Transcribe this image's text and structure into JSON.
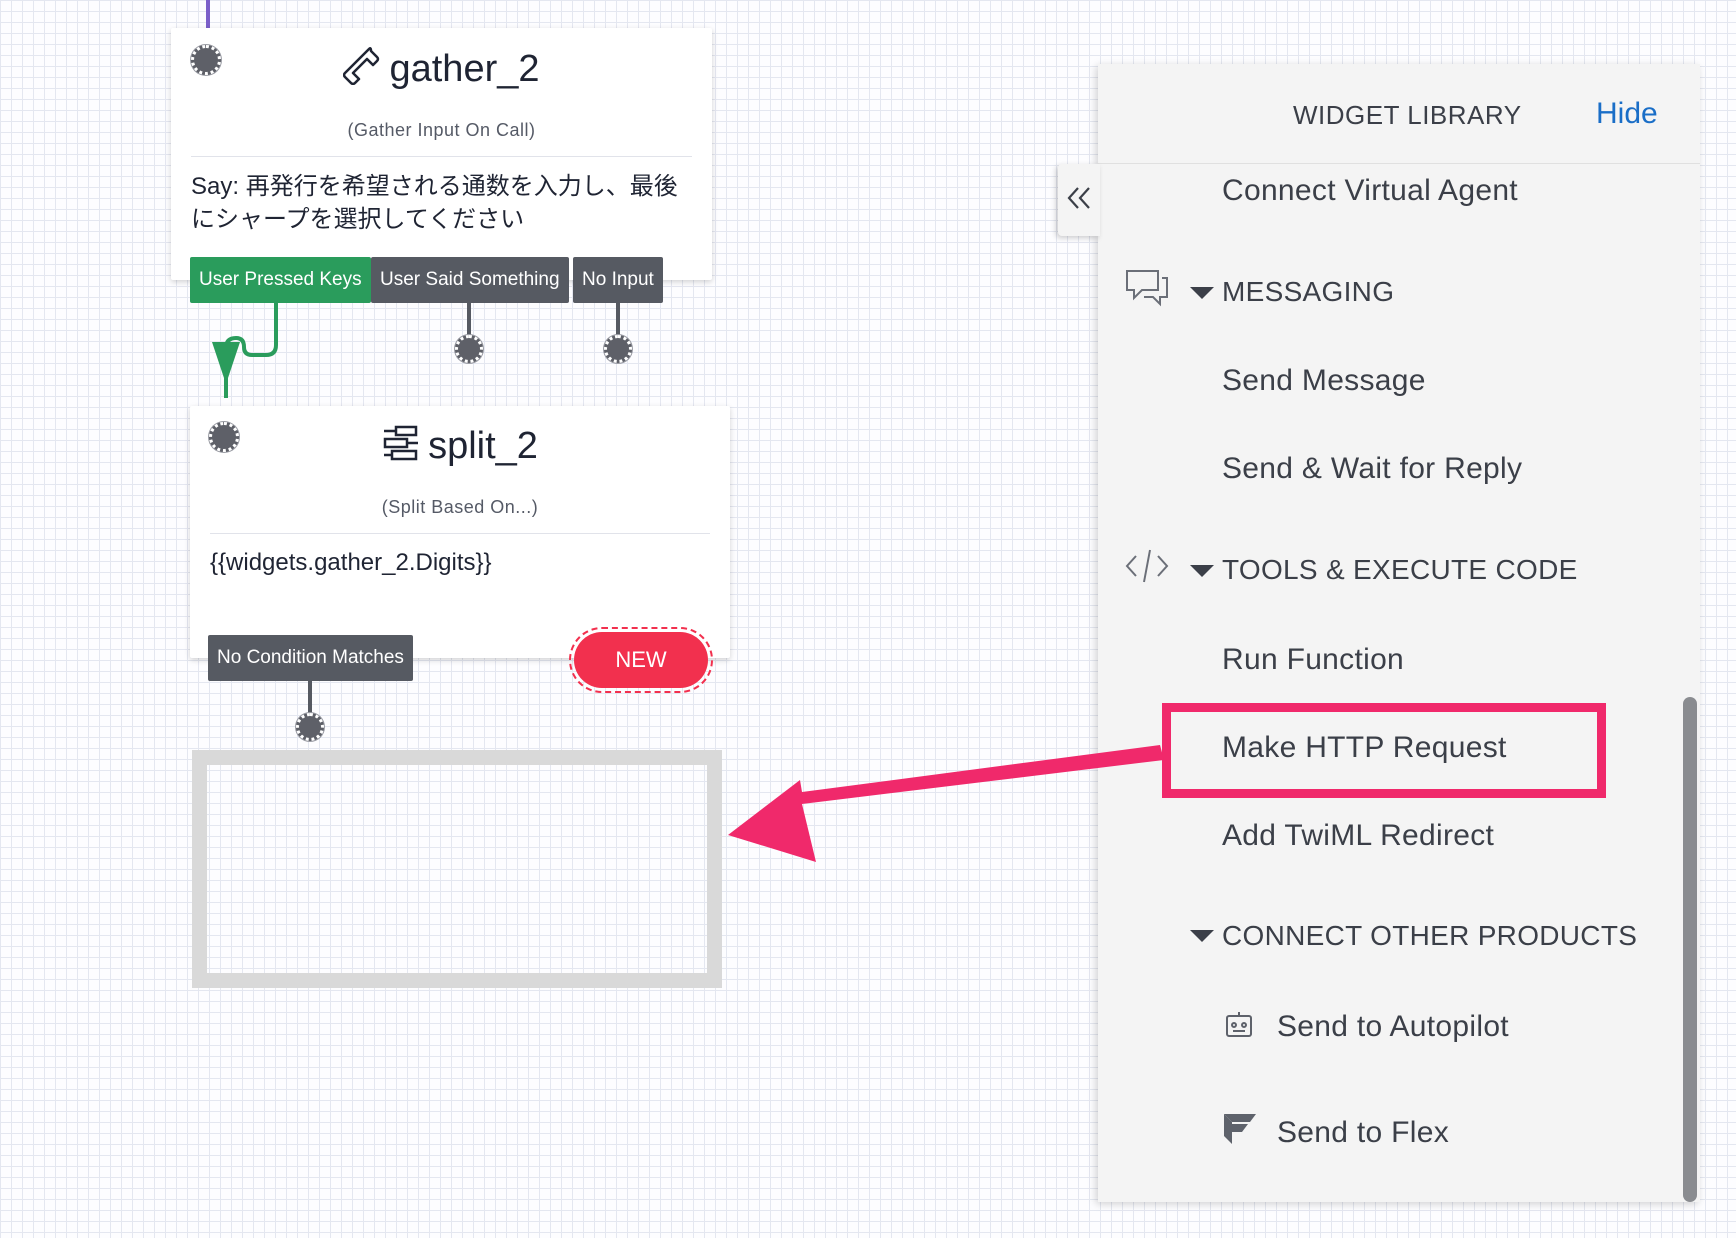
{
  "canvas": {
    "gather_widget": {
      "name": "gather_2",
      "type_label": "(Gather Input On Call)",
      "body": "Say: 再発行を希望される通数を入力し、最後にシャープを選択してください",
      "transitions": [
        "User Pressed Keys",
        "User Said Something",
        "No Input"
      ]
    },
    "split_widget": {
      "name": "split_2",
      "type_label": "(Split Based On...)",
      "body": "{{widgets.gather_2.Digits}}",
      "transitions": [
        "No Condition Matches"
      ],
      "new_button": "NEW"
    }
  },
  "widget_library": {
    "title": "WIDGET LIBRARY",
    "hide_label": "Hide",
    "items_top": [
      "Connect Virtual Agent"
    ],
    "sections": [
      {
        "label": "MESSAGING",
        "icon": "chat-bubble-icon",
        "items": [
          "Send Message",
          "Send & Wait for Reply"
        ]
      },
      {
        "label": "TOOLS & EXECUTE CODE",
        "icon": "code-icon",
        "items": [
          "Run Function",
          "Make HTTP Request",
          "Add TwiML Redirect"
        ]
      },
      {
        "label": "CONNECT OTHER PRODUCTS",
        "icon": "",
        "items": [
          "Send to Autopilot",
          "Send to Flex"
        ]
      }
    ],
    "highlighted_item": "Make HTTP Request"
  },
  "colors": {
    "accent_green": "#2a9c5c",
    "new_red": "#f2304e",
    "highlight_pink": "#f0296b",
    "link_blue": "#1a6ec7",
    "transition_grey": "#565a62"
  }
}
